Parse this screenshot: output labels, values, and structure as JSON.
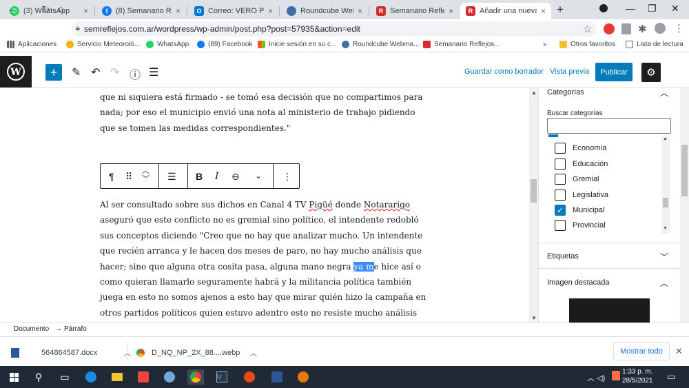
{
  "browser": {
    "tabs": [
      {
        "label": "(3) WhatsApp",
        "color": "#25d366"
      },
      {
        "label": "(8) Semanario Reflejos",
        "color": "#1877f2"
      },
      {
        "label": "Correo: VERO PIANA",
        "color": "#0078d4"
      },
      {
        "label": "Roundcube Webmail",
        "color": "#3d6fa5"
      },
      {
        "label": "Semanario Reflejos",
        "color": "#d32f2f"
      },
      {
        "label": "Añadir una nueva entrada",
        "color": "#d32f2f"
      }
    ],
    "new_tab": "+",
    "url": "semreflejos.com.ar/wordpress/wp-admin/post.php?post=57935&action=edit",
    "bookmarks": [
      {
        "label": "Aplicaciones",
        "color": "#5f6368"
      },
      {
        "label": "Servicio Meteoroló...",
        "color": "#f4b400"
      },
      {
        "label": "WhatsApp",
        "color": "#25d366"
      },
      {
        "label": "(89) Facebook",
        "color": "#1877f2"
      },
      {
        "label": "Inicie sesión en su c...",
        "color": "#f35325"
      },
      {
        "label": "Roundcube Webma...",
        "color": "#3d6fa5"
      },
      {
        "label": "Semanario Reflejos...",
        "color": "#d32f2f"
      }
    ],
    "bookmarks_overflow": "»",
    "other_favorites": "Otros favoritos",
    "reading_list": "Lista de lectura"
  },
  "wp_header": {
    "save_draft": "Guardar como borrador",
    "preview": "Vista previa",
    "publish": "Publicar"
  },
  "editor": {
    "para1": "que ni siquiera está firmado - se tomó esa decisión que no compartimos para nada; por eso el municipio envió una nota al ministerio de trabajo pidiendo que se tomen las medidas correspondientes.\"",
    "para2_a": "Al ser consultado sobre sus dichos en Canal 4 TV ",
    "para2_b": "Pigüé",
    "para2_c": " donde ",
    "para2_d": "Notararigo",
    "para2_e": " aseguró que este conflicto no es gremial sino político, el intendente redobló sus conceptos diciendo \"Creo que no hay que analizar mucho. Un intendente que recién arranca y le hacen dos meses de paro, no hay mucho análisis que hacer; sino que alguna otra cosita pasa, alguna mano negra ",
    "para2_sel": "ya m",
    "para2_f": "e hice así o como quieran llamarlo seguramente habrá y la militancia política también juega en esto no somos ajenos a esto hay que mirar quién hizo la campaña en otros partidos políticos quien estuvo adentro esto no resiste mucho análisis"
  },
  "sidebar": {
    "categories_title": "Categorías",
    "search_label": "Buscar categorías",
    "categories": [
      {
        "label": "Economía",
        "checked": false
      },
      {
        "label": "Educación",
        "checked": false
      },
      {
        "label": "Gremial",
        "checked": false
      },
      {
        "label": "Legislativa",
        "checked": false
      },
      {
        "label": "Municipal",
        "checked": true
      },
      {
        "label": "Provincial",
        "checked": false
      }
    ],
    "tags_title": "Etiquetas",
    "featured_title": "Imagen destacada"
  },
  "breadcrumb": {
    "root": "Documento",
    "arrow": "→",
    "current": "Párrafo"
  },
  "downloads": {
    "items": [
      "564864587.docx",
      "D_NQ_NP_2X_88....webp"
    ],
    "show_all": "Mostrar todo"
  },
  "taskbar": {
    "time": "1:33 p. m.",
    "date": "28/5/2021"
  }
}
